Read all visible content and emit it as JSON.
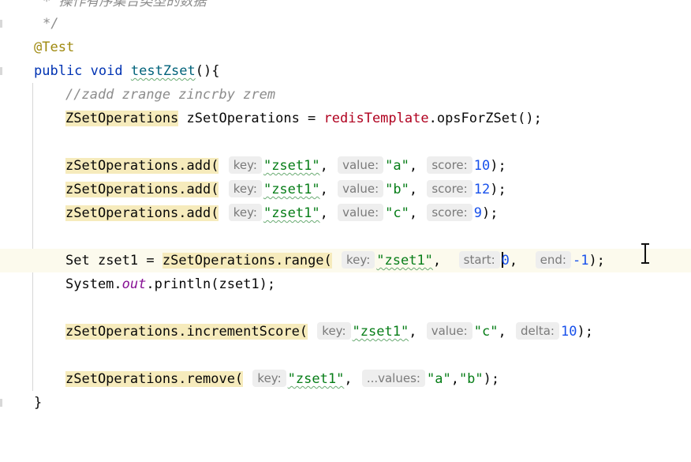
{
  "editor": {
    "doc_comment_partial": "* 操作有序集合类型的数据",
    "doc_comment_end": "*/",
    "annotation": "@Test",
    "method_decl": {
      "kw_public": "public",
      "kw_void": "void",
      "name": "testZset",
      "open": "(){"
    },
    "comment_line": "//zadd zrange zincrby zrem",
    "decl": {
      "type": "ZSetOperations",
      "var": " zSetOperations = ",
      "field": "redisTemplate",
      "call": ".opsForZSet();"
    },
    "add_calls": [
      {
        "target": "zSetOperations.add(",
        "hint_key": "key:",
        "key": "\"zset1\"",
        "sep1": ",",
        "hint_value": "value:",
        "value": "\"a\"",
        "sep2": ",",
        "hint_score": "score:",
        "score": "10",
        "end": ");"
      },
      {
        "target": "zSetOperations.add(",
        "hint_key": "key:",
        "key": "\"zset1\"",
        "sep1": ",",
        "hint_value": "value:",
        "value": "\"b\"",
        "sep2": ",",
        "hint_score": "score:",
        "score": "12",
        "end": ");"
      },
      {
        "target": "zSetOperations.add(",
        "hint_key": "key:",
        "key": "\"zset1\"",
        "sep1": ",",
        "hint_value": "value:",
        "value": "\"c\"",
        "sep2": ",",
        "hint_score": "score:",
        "score": "9",
        "end": ");"
      }
    ],
    "range_line": {
      "type": "Set",
      "var": " zset1 = ",
      "target": "zSetOperations.range(",
      "hint_key": "key:",
      "key": "\"zset1\"",
      "sep1": ",",
      "hint_start": "start:",
      "start": "0",
      "sep2": ",",
      "hint_end": "end:",
      "end_val": "-1",
      "close": ");"
    },
    "print_line": {
      "cls": "System.",
      "field": "out",
      "rest": ".println(zset1);"
    },
    "increment_line": {
      "target": "zSetOperations.incrementScore(",
      "hint_key": "key:",
      "key": "\"zset1\"",
      "sep1": ",",
      "hint_value": "value:",
      "value": "\"c\"",
      "sep2": ",",
      "hint_delta": "delta:",
      "delta": "10",
      "close": ");"
    },
    "remove_line": {
      "target": "zSetOperations.remove(",
      "hint_key": "key:",
      "key": "\"zset1\"",
      "sep1": ",",
      "hint_values": "...values:",
      "v1": "\"a\"",
      "comma": ",",
      "v2": "\"b\"",
      "close": ");"
    },
    "closing_brace": "}"
  }
}
